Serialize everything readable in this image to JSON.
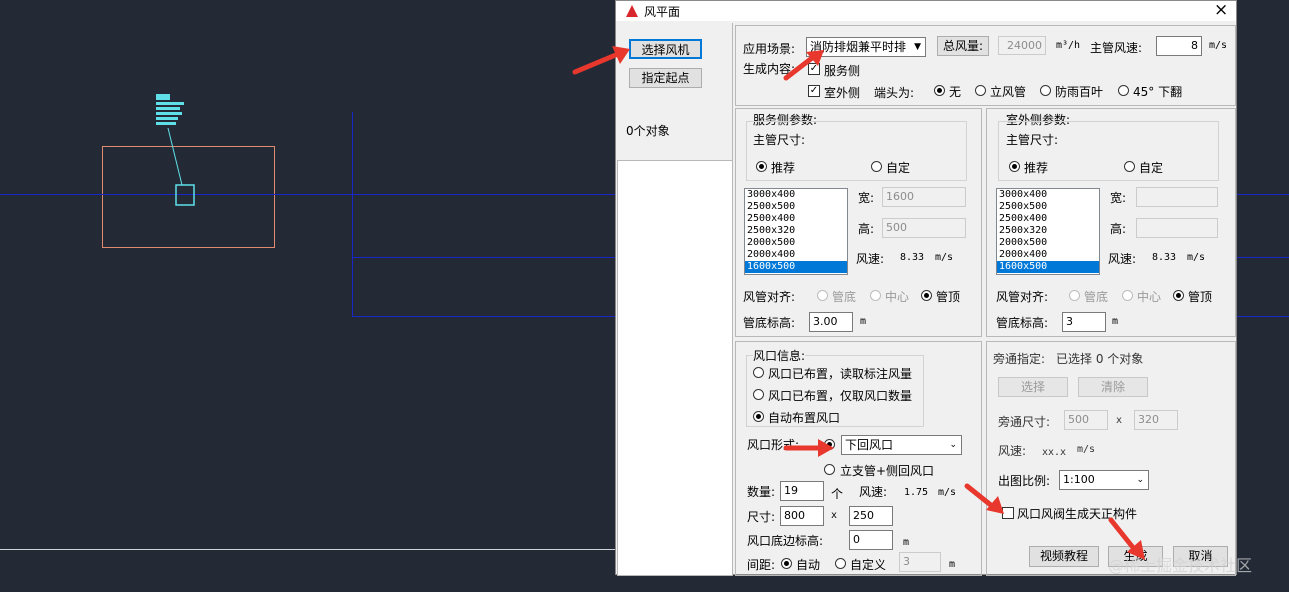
{
  "dialog": {
    "title": "风平面",
    "close": "×"
  },
  "left": {
    "select_fan": "选择风机",
    "set_start": "指定起点",
    "count": "0个对象"
  },
  "top": {
    "scene_label": "应用场景:",
    "scene_value": "消防排烟兼平时排",
    "total_air_btn": "总风量:",
    "total_air_value": "24000",
    "total_air_unit": "m³/h",
    "main_speed_label": "主管风速:",
    "main_speed_value": "8",
    "main_speed_unit": "m/s",
    "gen_label": "生成内容:",
    "service_side": "服务侧",
    "outdoor_side": "室外侧",
    "end_label": "端头为:",
    "end_options": [
      "无",
      "立风管",
      "防雨百叶",
      "45° 下翻"
    ]
  },
  "service": {
    "title": "服务侧参数:",
    "main_size": "主管尺寸:",
    "recommend": "推荐",
    "custom": "自定",
    "sizes": [
      "3000x400",
      "2500x500",
      "2500x400",
      "2500x320",
      "2000x500",
      "2000x400",
      "1600x500"
    ],
    "width_label": "宽:",
    "width_value": "1600",
    "height_label": "高:",
    "height_value": "500",
    "speed_label": "风速:",
    "speed_value": "8.33",
    "speed_unit": "m/s",
    "align_label": "风管对齐:",
    "align_options": [
      "管底",
      "中心",
      "管顶"
    ],
    "elev_label": "管底标高:",
    "elev_value": "3.00",
    "elev_unit": "m"
  },
  "outdoor": {
    "title": "室外侧参数:",
    "main_size": "主管尺寸:",
    "recommend": "推荐",
    "custom": "自定",
    "sizes": [
      "3000x400",
      "2500x500",
      "2500x400",
      "2500x320",
      "2000x500",
      "2000x400",
      "1600x500"
    ],
    "width_label": "宽:",
    "height_label": "高:",
    "speed_label": "风速:",
    "speed_value": "8.33",
    "speed_unit": "m/s",
    "align_label": "风管对齐:",
    "align_options": [
      "管底",
      "中心",
      "管顶"
    ],
    "elev_label": "管底标高:",
    "elev_value": "3",
    "elev_unit": "m"
  },
  "outlet": {
    "title": "风口信息:",
    "opt1": "风口已布置，读取标注风量",
    "opt2": "风口已布置，仅取风口数量",
    "opt3": "自动布置风口",
    "form_label": "风口形式:",
    "form_value": "下回风口",
    "form_alt": "立支管+侧回风口",
    "qty_label": "数量:",
    "qty_value": "19",
    "qty_unit": "个",
    "speed_label": "风速:",
    "speed_value": "1.75",
    "speed_unit": "m/s",
    "size_label": "尺寸:",
    "size_w": "800",
    "size_x": "x",
    "size_h": "250",
    "bottom_label": "风口底边标高:",
    "bottom_value": "0",
    "bottom_unit": "m",
    "spacing_label": "间距:",
    "spacing_auto": "自动",
    "spacing_custom": "自定义",
    "spacing_value": "3",
    "spacing_unit": "m"
  },
  "bypass": {
    "label": "旁通指定:",
    "status": "已选择 0 个对象",
    "select_btn": "选择",
    "clear_btn": "清除",
    "size_label": "旁通尺寸:",
    "size_w": "500",
    "size_x": "x",
    "size_h": "320",
    "speed_label": "风速:",
    "speed_value": "xx.x",
    "speed_unit": "m/s",
    "scale_label": "出图比例:",
    "scale_value": "1:100",
    "valve_label": "风口风阀生成天正构件"
  },
  "footer": {
    "video": "视频教程",
    "generate": "生成",
    "cancel": "取消",
    "watermark": "@稀土掘金技术社区"
  },
  "colors": {
    "canvas_bg": "#232a36",
    "cad_blue": "#1a27c8",
    "cad_cyan": "#5fe0e8",
    "rect_orange": "#e08a70",
    "annotation_red": "#e8372d",
    "list_selected": "#0078d7"
  }
}
